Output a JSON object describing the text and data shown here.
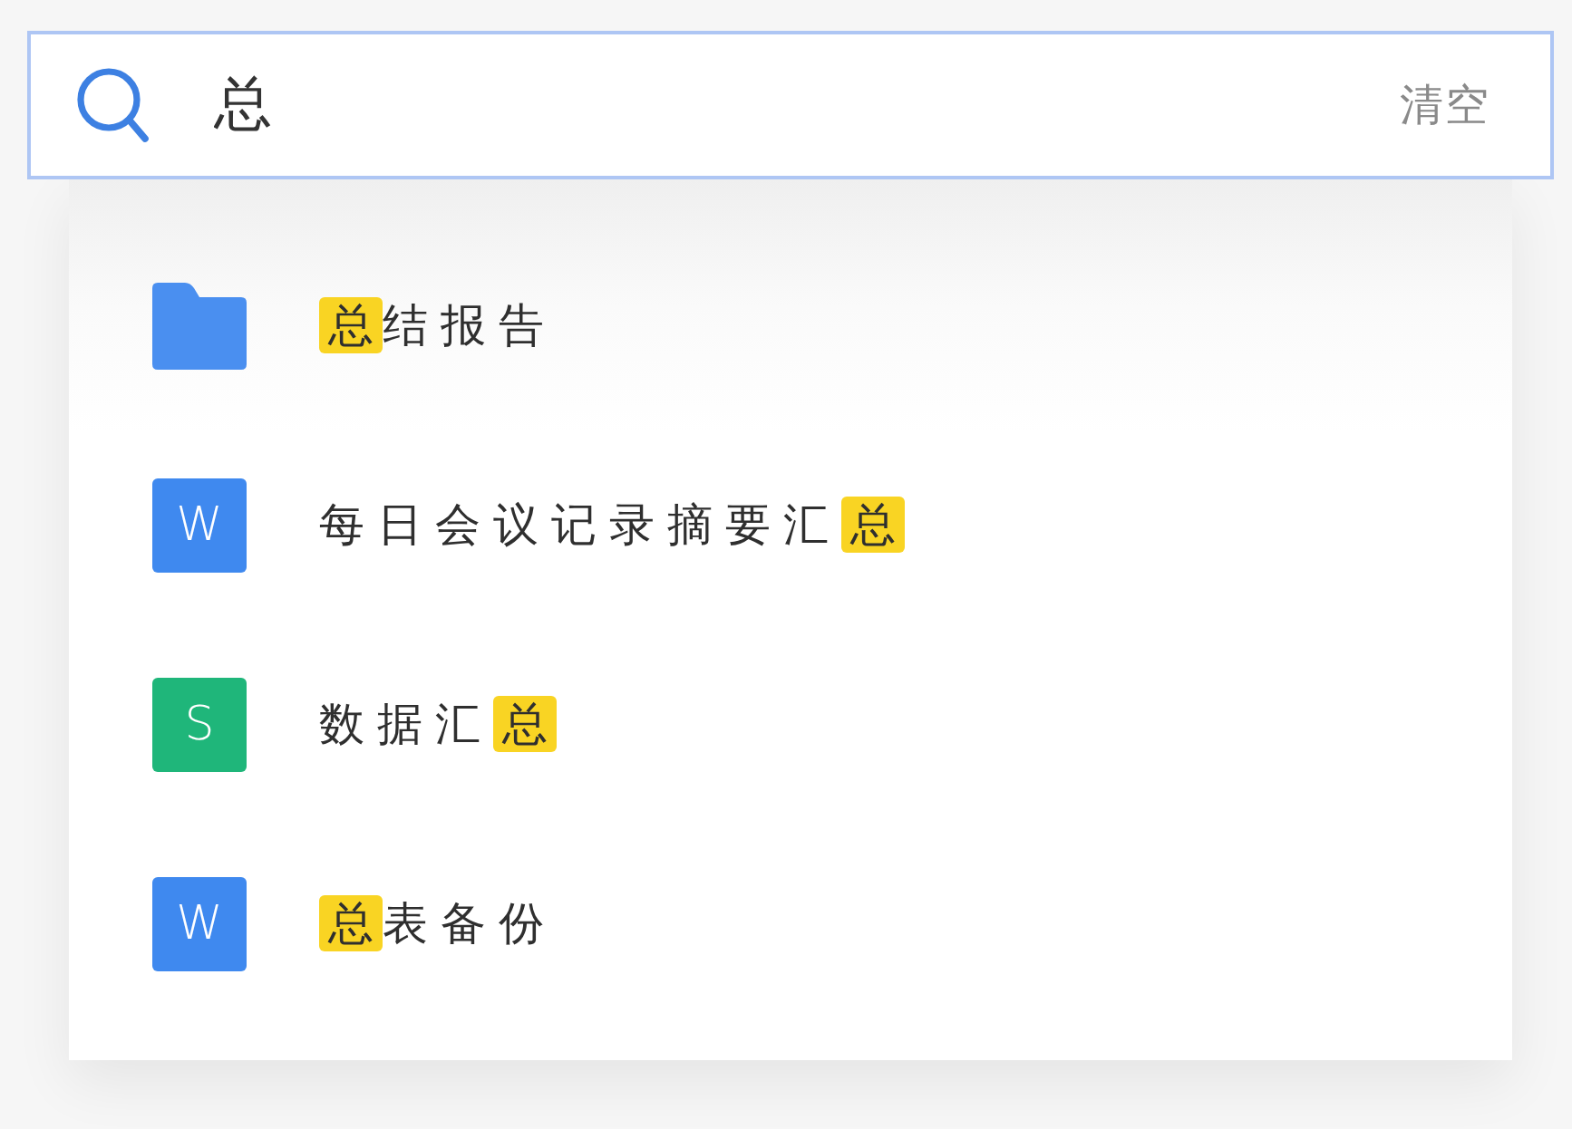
{
  "search": {
    "value": "总",
    "clear_label": "清空"
  },
  "results": [
    {
      "kind": "folder",
      "name": [
        {
          "text": "总",
          "highlighted": true
        },
        {
          "text": "结报告",
          "highlighted": false
        }
      ]
    },
    {
      "kind": "document",
      "badge": "W",
      "name": [
        {
          "text": "每日会议记录摘要汇",
          "highlighted": false
        },
        {
          "text": "总",
          "highlighted": true
        }
      ]
    },
    {
      "kind": "spreadsheet",
      "badge": "S",
      "name": [
        {
          "text": "数据汇",
          "highlighted": false
        },
        {
          "text": "总",
          "highlighted": true
        }
      ]
    },
    {
      "kind": "document",
      "badge": "W",
      "name": [
        {
          "text": "总",
          "highlighted": true
        },
        {
          "text": "表备份",
          "highlighted": false
        }
      ]
    }
  ]
}
